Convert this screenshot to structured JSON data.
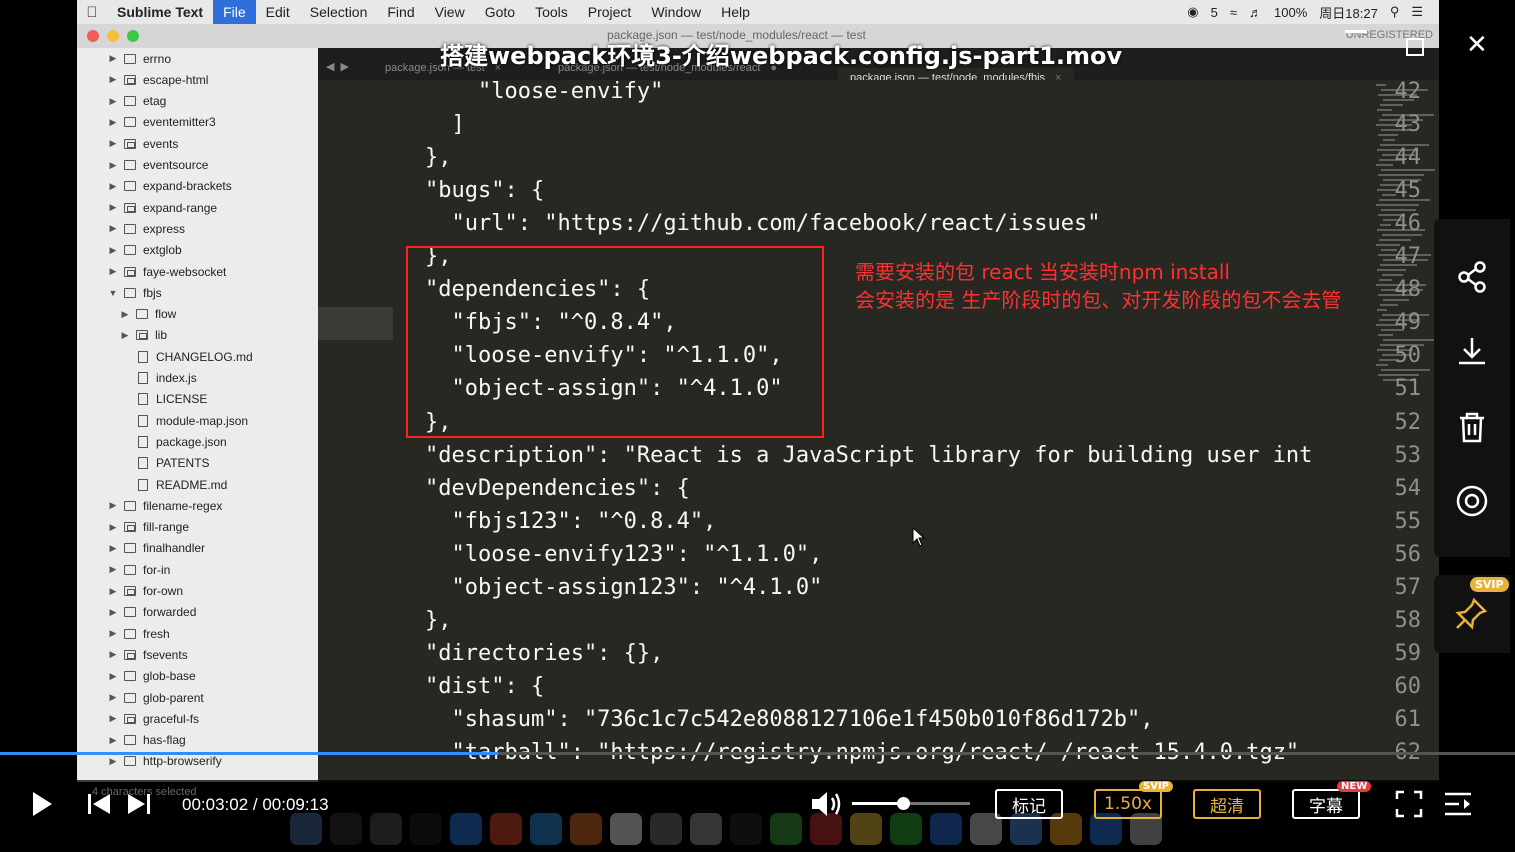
{
  "menubar": {
    "app": "Sublime Text",
    "items": [
      "File",
      "Edit",
      "Selection",
      "Find",
      "View",
      "Goto",
      "Tools",
      "Project",
      "Window",
      "Help"
    ],
    "active": "File",
    "status": {
      "battery": "100%",
      "clock": "周日18:27",
      "input": "5"
    }
  },
  "window": {
    "title": "package.json — test/node_modules/react — test",
    "unregistered": "UNREGISTERED"
  },
  "video": {
    "title": "搭建webpack环境3-介绍webpack.config.js-part1.mov"
  },
  "tabs": [
    {
      "label": "package.json — test"
    },
    {
      "label": "package.json — test/node_modules/react"
    },
    {
      "label": "package.json — test/node_modules/fbjs"
    }
  ],
  "sidebar": {
    "items": [
      {
        "label": "errno",
        "type": "folder",
        "depth": 0
      },
      {
        "label": "escape-html",
        "type": "folder",
        "depth": 0
      },
      {
        "label": "etag",
        "type": "folder",
        "depth": 0
      },
      {
        "label": "eventemitter3",
        "type": "folder",
        "depth": 0
      },
      {
        "label": "events",
        "type": "folder",
        "depth": 0
      },
      {
        "label": "eventsource",
        "type": "folder",
        "depth": 0
      },
      {
        "label": "expand-brackets",
        "type": "folder",
        "depth": 0
      },
      {
        "label": "expand-range",
        "type": "folder",
        "depth": 0
      },
      {
        "label": "express",
        "type": "folder",
        "depth": 0
      },
      {
        "label": "extglob",
        "type": "folder",
        "depth": 0
      },
      {
        "label": "faye-websocket",
        "type": "folder",
        "depth": 0
      },
      {
        "label": "fbjs",
        "type": "folder-open",
        "depth": 0
      },
      {
        "label": "flow",
        "type": "folder",
        "depth": 1
      },
      {
        "label": "lib",
        "type": "folder",
        "depth": 1
      },
      {
        "label": "CHANGELOG.md",
        "type": "file",
        "depth": 1
      },
      {
        "label": "index.js",
        "type": "file",
        "depth": 1
      },
      {
        "label": "LICENSE",
        "type": "file",
        "depth": 1
      },
      {
        "label": "module-map.json",
        "type": "file",
        "depth": 1
      },
      {
        "label": "package.json",
        "type": "file",
        "depth": 1
      },
      {
        "label": "PATENTS",
        "type": "file",
        "depth": 1
      },
      {
        "label": "README.md",
        "type": "file",
        "depth": 1
      },
      {
        "label": "filename-regex",
        "type": "folder",
        "depth": 0
      },
      {
        "label": "fill-range",
        "type": "folder",
        "depth": 0
      },
      {
        "label": "finalhandler",
        "type": "folder",
        "depth": 0
      },
      {
        "label": "for-in",
        "type": "folder",
        "depth": 0
      },
      {
        "label": "for-own",
        "type": "folder",
        "depth": 0
      },
      {
        "label": "forwarded",
        "type": "folder",
        "depth": 0
      },
      {
        "label": "fresh",
        "type": "folder",
        "depth": 0
      },
      {
        "label": "fsevents",
        "type": "folder",
        "depth": 0
      },
      {
        "label": "glob-base",
        "type": "folder",
        "depth": 0
      },
      {
        "label": "glob-parent",
        "type": "folder",
        "depth": 0
      },
      {
        "label": "graceful-fs",
        "type": "folder",
        "depth": 0
      },
      {
        "label": "has-flag",
        "type": "folder",
        "depth": 0
      },
      {
        "label": "http-browserify",
        "type": "folder",
        "depth": 0
      }
    ],
    "status": "4 characters selected"
  },
  "editor": {
    "current_line": "49",
    "lines": [
      {
        "n": "42",
        "t": "    \"loose-envify\""
      },
      {
        "n": "43",
        "t": "  ]"
      },
      {
        "n": "44",
        "t": "},"
      },
      {
        "n": "45",
        "t": "\"bugs\": {"
      },
      {
        "n": "46",
        "t": "  \"url\": \"https://github.com/facebook/react/issues\""
      },
      {
        "n": "47",
        "t": "},"
      },
      {
        "n": "48",
        "t": "\"dependencies\": {"
      },
      {
        "n": "49",
        "t": "  \"fbjs\": \"^0.8.4\","
      },
      {
        "n": "50",
        "t": "  \"loose-envify\": \"^1.1.0\","
      },
      {
        "n": "51",
        "t": "  \"object-assign\": \"^4.1.0\""
      },
      {
        "n": "52",
        "t": "},"
      },
      {
        "n": "53",
        "t": "\"description\": \"React is a JavaScript library for building user int"
      },
      {
        "n": "54",
        "t": "\"devDependencies\": {"
      },
      {
        "n": "55",
        "t": "  \"fbjs123\": \"^0.8.4\","
      },
      {
        "n": "56",
        "t": "  \"loose-envify123\": \"^1.1.0\","
      },
      {
        "n": "57",
        "t": "  \"object-assign123\": \"^4.1.0\""
      },
      {
        "n": "58",
        "t": "},"
      },
      {
        "n": "59",
        "t": "\"directories\": {},"
      },
      {
        "n": "60",
        "t": "\"dist\": {"
      },
      {
        "n": "61",
        "t": "  \"shasum\": \"736c1c7c542e8088127106e1f450b010f86d172b\","
      },
      {
        "n": "62",
        "t": "  \"tarball\": \"https://registry.npmjs.org/react/-/react-15.4.0.tgz\""
      }
    ]
  },
  "annotation": {
    "line1": "需要安装的包 react  当安装时npm install",
    "line2": "会安装的是 生产阶段时的包、对开发阶段的包不会去管"
  },
  "player": {
    "current_time": "00:03:02",
    "total_time": "00:09:13",
    "time_text": "00:03:02 / 00:09:13",
    "progress": 0.329,
    "volume": 0.43,
    "mark_label": "标记",
    "speed_label": "1.50x",
    "quality_label": "超清",
    "subtitle_label": "字幕",
    "svip_badge": "SVIP",
    "new_badge": "NEW",
    "side_svip": "SVIP",
    "colors": {
      "accent": "#2f8fff",
      "gold": "#e8b23a",
      "annotation": "#ff2020"
    }
  }
}
